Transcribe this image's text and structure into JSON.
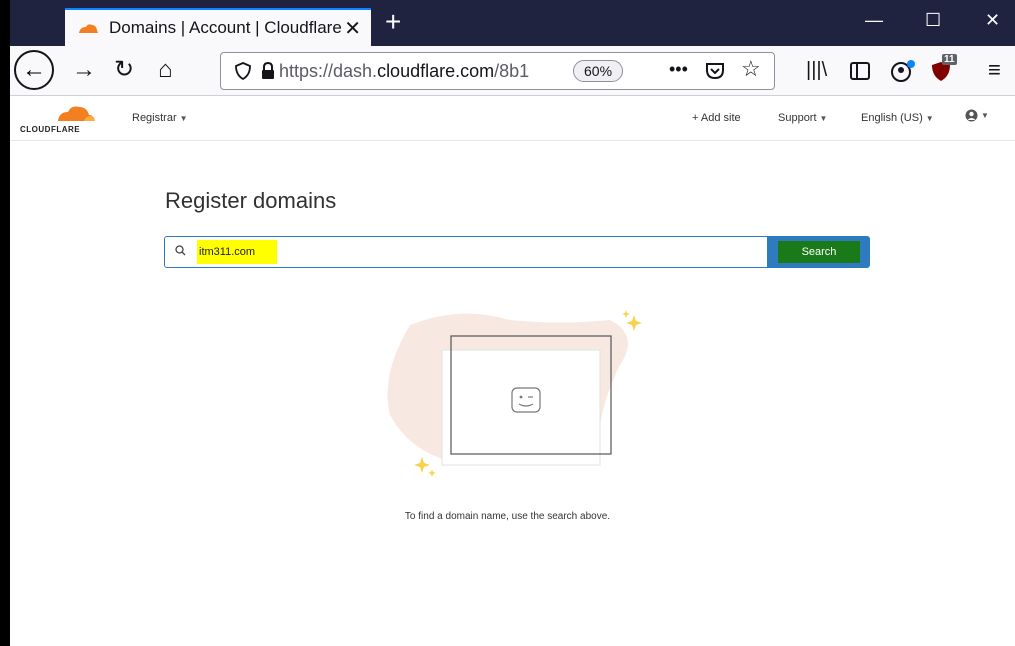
{
  "browser": {
    "tab_title": "Domains | Account | Cloudflare",
    "tab_close": "✕",
    "new_tab": "+",
    "url_prefix": "https://dash.",
    "url_domain": "cloudflare.com",
    "url_suffix": "/8b1",
    "zoom": "60%",
    "ublock_count": "11",
    "window_controls": [
      "—",
      "☐",
      "✕"
    ],
    "icons": [
      "back-icon",
      "forward-icon",
      "reload-icon",
      "home-icon",
      "shield-icon",
      "lock-icon",
      "more-icon",
      "pocket-icon",
      "star-icon",
      "library-icon",
      "sidebar-icon",
      "account-icon",
      "ublock-icon",
      "menu-icon"
    ]
  },
  "header": {
    "logo_text": "CLOUDFLARE",
    "registrar": "Registrar",
    "add_site": "+ Add site",
    "support": "Support",
    "language": "English (US)",
    "user_icon": "user-icon"
  },
  "main": {
    "title": "Register domains",
    "search_value": "itm311.com",
    "search_button": "Search",
    "empty_message": "To find a domain name, use the search above."
  },
  "colors": {
    "tabstrip": "#202340",
    "accent_blue": "#2f7bbf",
    "search_green": "#1a7a1a",
    "highlight": "#ffff00",
    "cf_orange": "#f38020"
  }
}
